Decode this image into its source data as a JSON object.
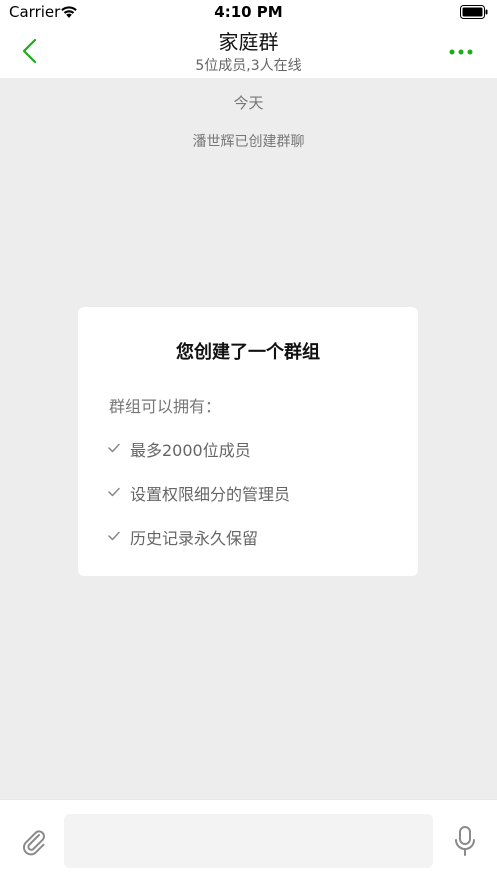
{
  "status_bar": {
    "carrier": "Carrier",
    "time": "4:10 PM"
  },
  "nav": {
    "title": "家庭群",
    "subtitle": "5位成员,3人在线",
    "back_icon": "chevron-left-icon",
    "more_icon": "more-dots-icon",
    "accent_color": "#1aad19"
  },
  "chat": {
    "date_label": "今天",
    "system_message": "潘世辉已创建群聊",
    "background_color": "#ededed"
  },
  "info_card": {
    "title": "您创建了一个群组",
    "subtitle": "群组可以拥有：",
    "features": [
      "最多2000位成员",
      "设置权限细分的管理员",
      "历史记录永久保留"
    ]
  },
  "input_bar": {
    "placeholder": "",
    "value": "",
    "attach_icon": "paperclip-icon",
    "mic_icon": "microphone-icon"
  }
}
